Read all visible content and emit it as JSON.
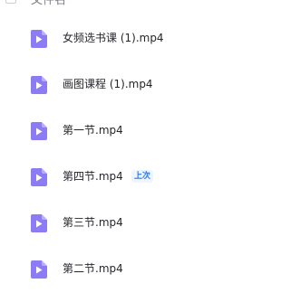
{
  "header": {
    "column_label": "文件名",
    "sort_icon": "chevron-down-icon"
  },
  "files": [
    {
      "name": "女频选书课 (1).mp4",
      "icon": "video-file-icon",
      "badge": ""
    },
    {
      "name": "画图课程 (1).mp4",
      "icon": "video-file-icon",
      "badge": ""
    },
    {
      "name": "第一节.mp4",
      "icon": "video-file-icon",
      "badge": ""
    },
    {
      "name": "第四节.mp4",
      "icon": "video-file-icon",
      "badge": "上次"
    },
    {
      "name": "第三节.mp4",
      "icon": "video-file-icon",
      "badge": ""
    },
    {
      "name": "第二节.mp4",
      "icon": "video-file-icon",
      "badge": ""
    }
  ],
  "colors": {
    "icon_fill": "#8b7cf6",
    "icon_fold": "#b8aefb",
    "badge_text": "#2f7be8",
    "badge_bg": "#eef5ff",
    "text": "#25262b"
  }
}
